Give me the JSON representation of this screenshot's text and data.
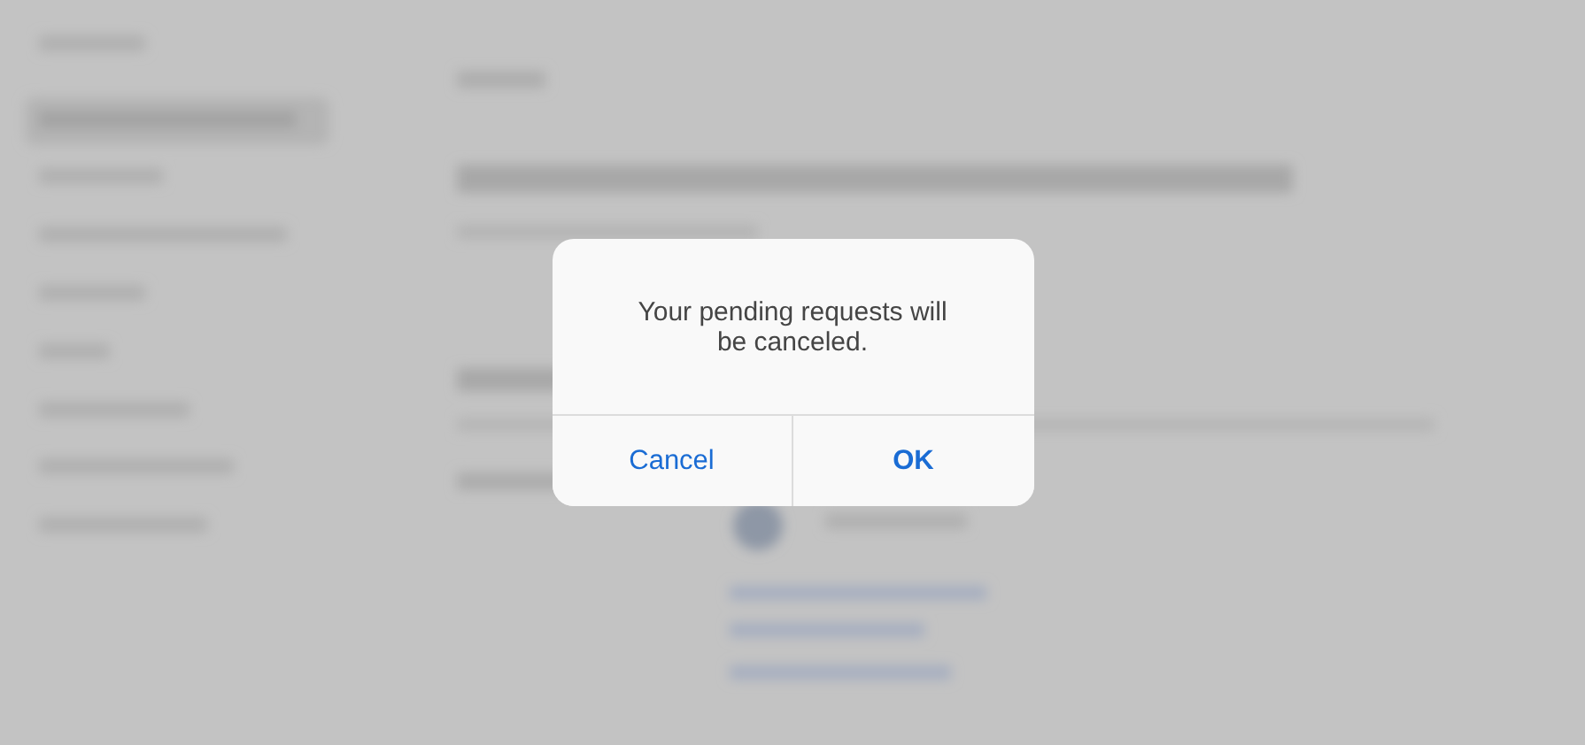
{
  "dialog": {
    "message": "Your pending requests will be canceled.",
    "buttons": [
      {
        "label": "Cancel",
        "kind": "cancel"
      },
      {
        "label": "OK",
        "kind": "confirm"
      }
    ]
  }
}
